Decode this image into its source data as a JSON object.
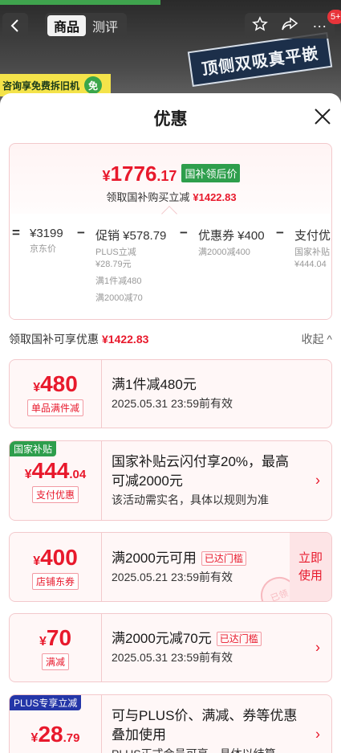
{
  "nav": {
    "tabs": [
      "商品",
      "测评"
    ],
    "active_tab": 0,
    "badge": "5+",
    "bg_sign": "顶侧双吸真平嵌",
    "bg_banner": "咨询享免费拆旧机",
    "bg_banner_badge": "免"
  },
  "sheet": {
    "title": "优惠"
  },
  "summary": {
    "currency": "¥",
    "price_int": "1776",
    "price_dec": ".17",
    "price_tag": "国补领后价",
    "sub_text": "领取国补购买立减",
    "sub_amount": "¥1422.83",
    "breakdown": [
      {
        "op": "=",
        "main": "¥3199",
        "subs": [
          "京东价"
        ]
      },
      {
        "op": "−",
        "main": "促销 ¥578.79",
        "subs": [
          "PLUS立减",
          "¥28.79元",
          "满1件减480",
          "满2000减70"
        ]
      },
      {
        "op": "−",
        "main": "优惠券 ¥400",
        "subs": [
          "满2000减400"
        ]
      },
      {
        "op": "−",
        "main": "支付优惠",
        "subs": [
          "国家补贴",
          "¥444.04"
        ]
      }
    ]
  },
  "section": {
    "title": "领取国补可享优惠",
    "amount": "¥1422.83",
    "collapse": "收起 ^"
  },
  "cards": [
    {
      "ribbon": "",
      "cur": "¥",
      "int": "480",
      "dec": "",
      "pill": "单品满件减",
      "title": "满1件减480元",
      "hint": "",
      "line2": "2025.05.31 23:59前有效",
      "action": ""
    },
    {
      "ribbon": "国家补贴",
      "cur": "¥",
      "int": "444",
      "dec": ".04",
      "pill": "支付优惠",
      "title": "国家补贴云闪付享20%，最高",
      "title2": "可减2000元",
      "hint": "",
      "line2": "该活动需实名，具体以规则为准",
      "action": "›"
    },
    {
      "ribbon": "",
      "cur": "¥",
      "int": "400",
      "dec": "",
      "pill": "店铺东券",
      "title": "满2000元可用",
      "hint": "已达门槛",
      "line2": "2025.05.21 23:59前有效",
      "action": "立即使用",
      "stamp": "已领"
    },
    {
      "ribbon": "",
      "cur": "¥",
      "int": "70",
      "dec": "",
      "pill": "满减",
      "title": "满2000元减70元",
      "hint": "已达门槛",
      "line2": "2025.05.31 23:59前有效",
      "action": "›"
    },
    {
      "ribbon": "PLUS专享立减",
      "cur": "¥",
      "int": "28",
      "dec": ".79",
      "pill": "",
      "title": "可与PLUS价、满减、券等优惠",
      "title2": "叠加使用",
      "hint": "",
      "line2": "PLUS正式会员可享，具体以结算",
      "action": "›"
    }
  ],
  "colors": {
    "accent": "#e8192c",
    "green": "#2e9e4c",
    "plus_blue": "#2436a8"
  }
}
